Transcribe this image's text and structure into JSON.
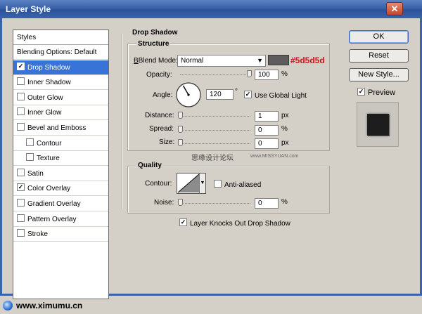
{
  "window": {
    "title": "Layer Style",
    "close_glyph": "✕"
  },
  "styles": {
    "header": "Styles",
    "items": [
      {
        "label": "Blending Options: Default",
        "checkbox": false,
        "checked": false,
        "selected": false,
        "indent": false
      },
      {
        "label": "Drop Shadow",
        "checkbox": true,
        "checked": true,
        "selected": true,
        "indent": false
      },
      {
        "label": "Inner Shadow",
        "checkbox": true,
        "checked": false,
        "selected": false,
        "indent": false
      },
      {
        "label": "Outer Glow",
        "checkbox": true,
        "checked": false,
        "selected": false,
        "indent": false
      },
      {
        "label": "Inner Glow",
        "checkbox": true,
        "checked": false,
        "selected": false,
        "indent": false
      },
      {
        "label": "Bevel and Emboss",
        "checkbox": true,
        "checked": false,
        "selected": false,
        "indent": false
      },
      {
        "label": "Contour",
        "checkbox": true,
        "checked": false,
        "selected": false,
        "indent": true
      },
      {
        "label": "Texture",
        "checkbox": true,
        "checked": false,
        "selected": false,
        "indent": true
      },
      {
        "label": "Satin",
        "checkbox": true,
        "checked": false,
        "selected": false,
        "indent": false
      },
      {
        "label": "Color Overlay",
        "checkbox": true,
        "checked": true,
        "selected": false,
        "indent": false
      },
      {
        "label": "Gradient Overlay",
        "checkbox": true,
        "checked": false,
        "selected": false,
        "indent": false
      },
      {
        "label": "Pattern Overlay",
        "checkbox": true,
        "checked": false,
        "selected": false,
        "indent": false
      },
      {
        "label": "Stroke",
        "checkbox": true,
        "checked": false,
        "selected": false,
        "indent": false
      }
    ]
  },
  "drop_shadow": {
    "title": "Drop Shadow",
    "structure": {
      "title": "Structure",
      "blend_mode_label": "Blend Mode:",
      "blend_mode_value": "Normal",
      "color_swatch": "#5d5d5d",
      "color_annotation": "#5d5d5d",
      "opacity_label": "Opacity:",
      "opacity_value": "100",
      "opacity_fraction": 1.0,
      "angle_label": "Angle:",
      "angle_value": "120",
      "angle_unit": "°",
      "use_global_light_label": "Use Global Light",
      "use_global_light": true,
      "distance_label": "Distance:",
      "distance_value": "1",
      "distance_fraction": 0.0,
      "spread_label": "Spread:",
      "spread_value": "0",
      "spread_fraction": 0.0,
      "size_label": "Size:",
      "size_value": "0",
      "size_fraction": 0.0,
      "unit_percent": "%",
      "unit_px": "px"
    },
    "quality": {
      "title": "Quality",
      "contour_label": "Contour:",
      "anti_aliased_label": "Anti-aliased",
      "anti_aliased": false,
      "noise_label": "Noise:",
      "noise_value": "0",
      "noise_fraction": 0.0
    },
    "knocks_out_label": "Layer Knocks Out Drop Shadow",
    "knocks_out": true
  },
  "buttons": {
    "ok": "OK",
    "reset": "Reset",
    "new_style": "New Style...",
    "preview_label": "Preview",
    "preview": true
  },
  "watermarks": {
    "site_cn": "思缘设计论坛",
    "site_url": "www.MISSYUAN.com",
    "bottom": "www.ximumu.cn"
  }
}
